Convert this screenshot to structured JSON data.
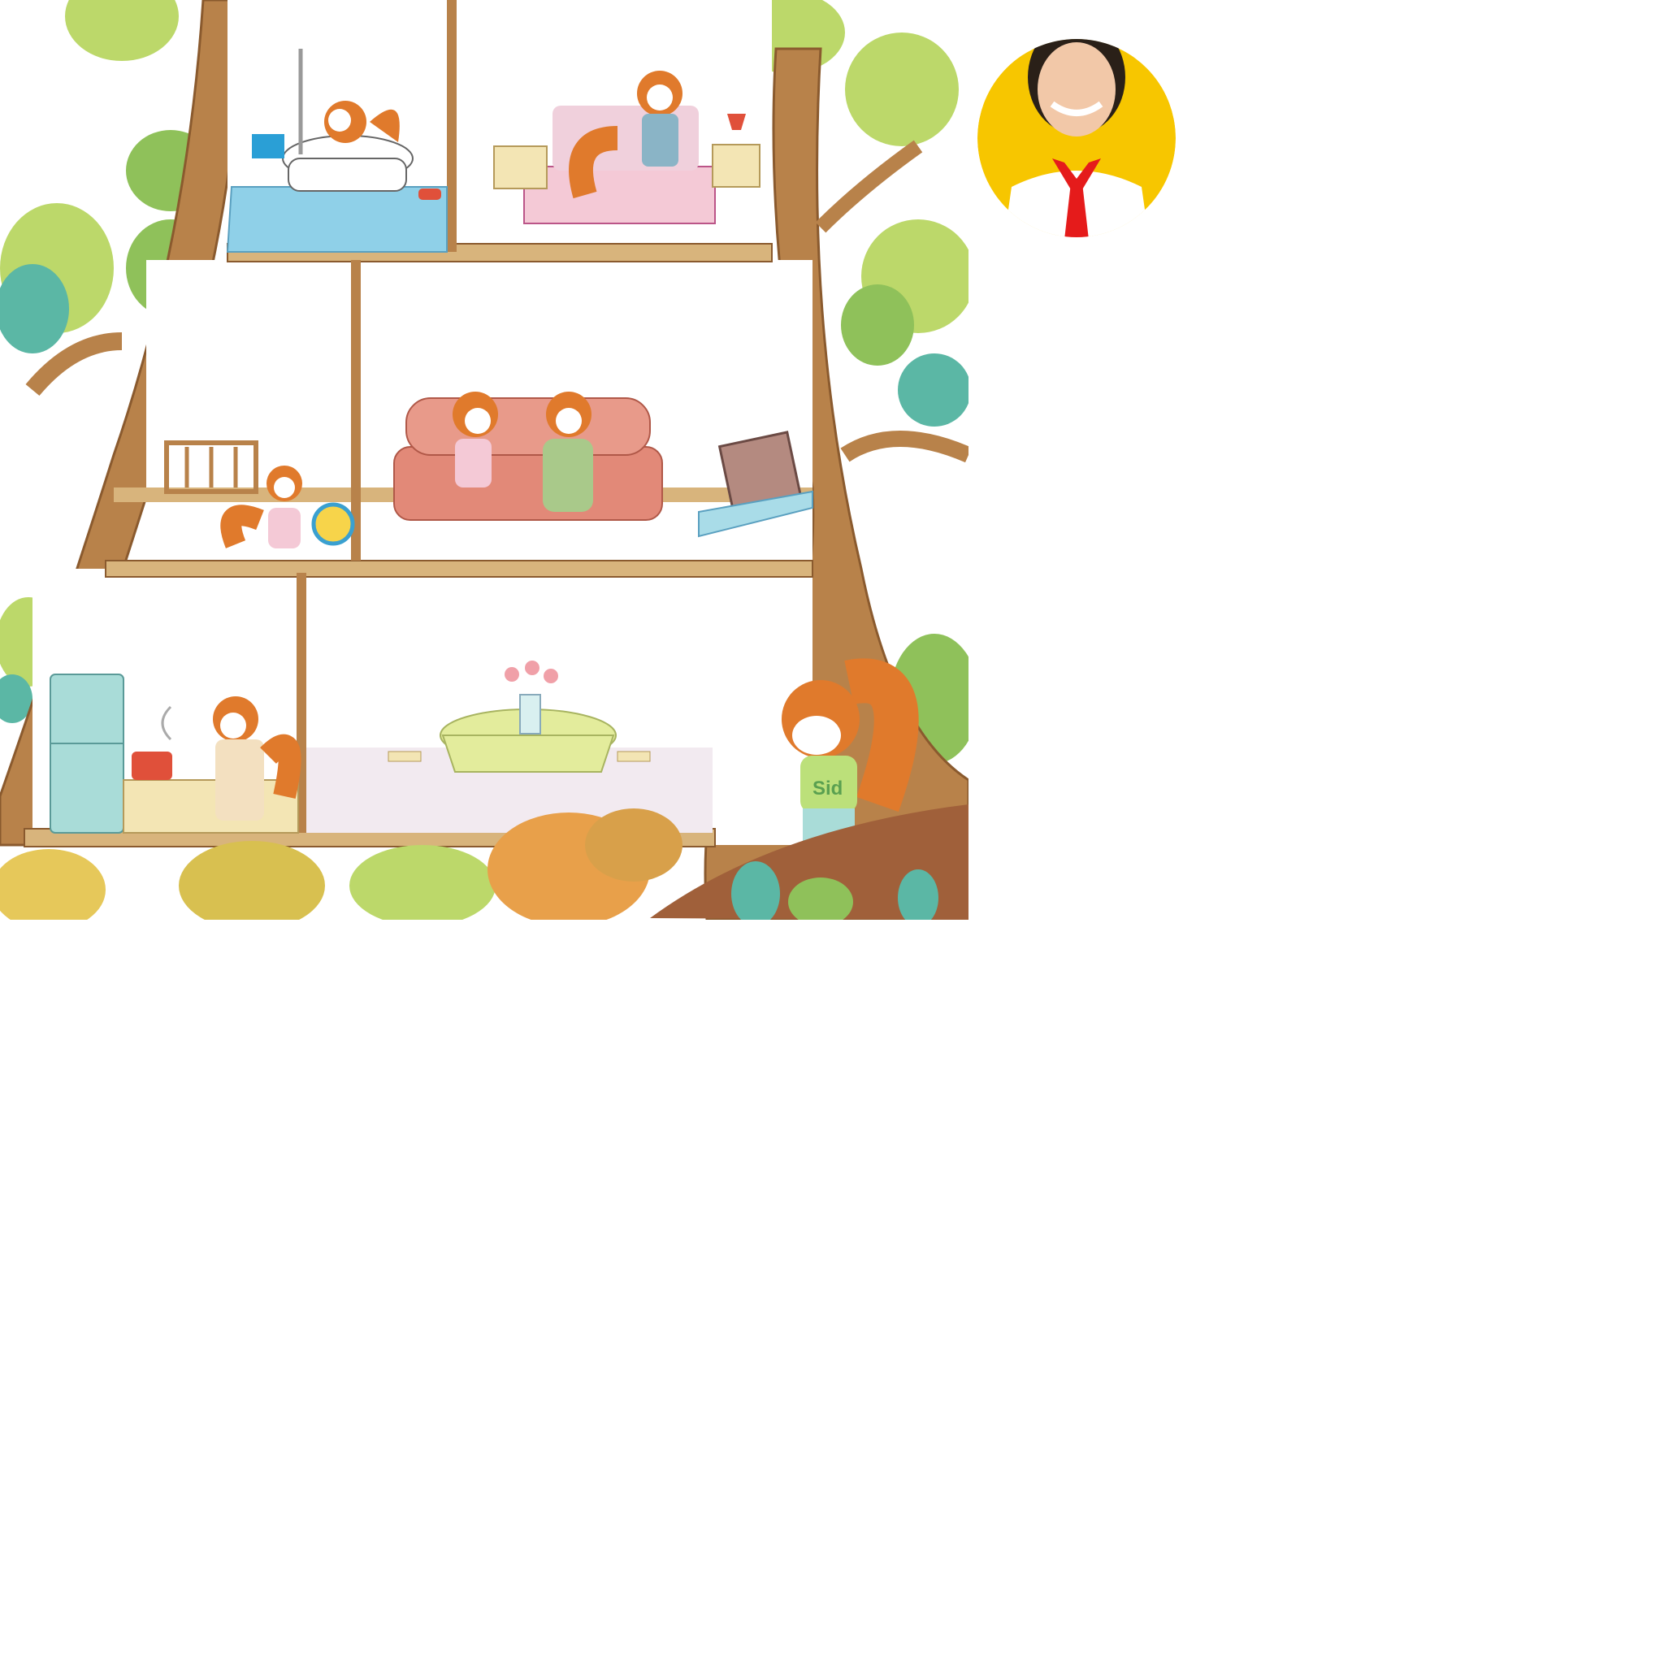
{
  "scene": {
    "shirt_label": "Sid",
    "palette": {
      "trunk": "#b8824a",
      "trunk_dark": "#8a5a2e",
      "floor": "#d8b47c",
      "wall": "#ffffff",
      "foliage_light": "#bcd86a",
      "foliage_mid": "#8fc15a",
      "foliage_teal": "#5bb7a5",
      "squirrel": "#e07a2c",
      "sofa": "#e28978",
      "bath_tile": "#8fd0e8",
      "bed": "#f4c9d6",
      "tablecloth": "#e3ec9c",
      "fridge": "#a9dcd8",
      "bush_orange": "#e8a04a",
      "bush_yellow": "#e6c85a",
      "avatar_bg": "#f7c600",
      "scarf": "#e51b1b"
    },
    "rooms": [
      "bathroom",
      "bedroom",
      "nursery",
      "living-room",
      "kitchen",
      "dining-room"
    ]
  }
}
